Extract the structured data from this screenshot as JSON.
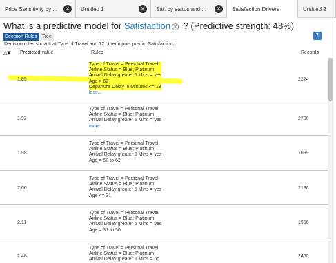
{
  "tabs": [
    {
      "label": "Price Sensitivity by ...",
      "close": "×"
    },
    {
      "label": "Untitled 1",
      "close": "×"
    },
    {
      "label": "Sat. by status and ...",
      "close": "×"
    },
    {
      "label": "Satisfaction Drivers",
      "close": "×"
    },
    {
      "label": "Untitled 2",
      "close": ""
    }
  ],
  "header": {
    "question_prefix": "What is a predictive model for",
    "target": "Satisfaction",
    "clear_symbol": "×",
    "question_suffix": "? (Predictive strength: 48%)",
    "help_symbol": "?"
  },
  "subtabs": {
    "decision_rules": "Decision Rules",
    "tree": "Tree"
  },
  "description": "Decision rules show that Type of Travel and 12 other inputs predict Satisfaction.",
  "table": {
    "sort_symbol": "△▼",
    "col_predicted": "Predicted value",
    "col_rules": "Rules",
    "col_records": "Records",
    "rows": [
      {
        "predicted": "1.89",
        "records": "2224",
        "highlighted": true,
        "rules": [
          "Type of Travel = Personal Travel",
          "Airline Status = Blue; Platinum",
          "Arrival Delay greater 5 Mins = yes",
          "Age > 62",
          "Departure Delay in Minutes <= 19"
        ],
        "more": "less..."
      },
      {
        "predicted": "1.92",
        "records": "2706",
        "highlighted": false,
        "rules": [
          "Type of Travel = Personal Travel",
          "Airline Status = Blue; Platinum",
          "Arrival Delay greater 5 Mins = yes"
        ],
        "more": "more..."
      },
      {
        "predicted": "1.98",
        "records": "1699",
        "highlighted": false,
        "rules": [
          "Type of Travel = Personal Travel",
          "Airline Status = Blue; Platinum",
          "Arrival Delay greater 5 Mins = yes",
          "Age = 50 to 62"
        ],
        "more": ""
      },
      {
        "predicted": "2.06",
        "records": "2136",
        "highlighted": false,
        "rules": [
          "Type of Travel = Personal Travel",
          "Airline Status = Blue; Platinum",
          "Arrival Delay greater 5 Mins = yes",
          "Age <= 31"
        ],
        "more": ""
      },
      {
        "predicted": "2.11",
        "records": "1956",
        "highlighted": false,
        "rules": [
          "Type of Travel = Personal Travel",
          "Airline Status = Blue; Platinum",
          "Arrival Delay greater 5 Mins = yes",
          "Age = 31 to 50"
        ],
        "more": ""
      },
      {
        "predicted": "2.48",
        "records": "2460",
        "highlighted": false,
        "rules": [
          "Type of Travel = Personal Travel",
          "Airline Status = Blue; Platinum",
          "Arrival Delay greater 5 Mins = no"
        ],
        "more": ""
      }
    ]
  },
  "colors": {
    "accent": "#2d84c4",
    "active_subtab": "#1f5a96",
    "highlight": "#ffff3a",
    "link": "#2d6fb0"
  }
}
